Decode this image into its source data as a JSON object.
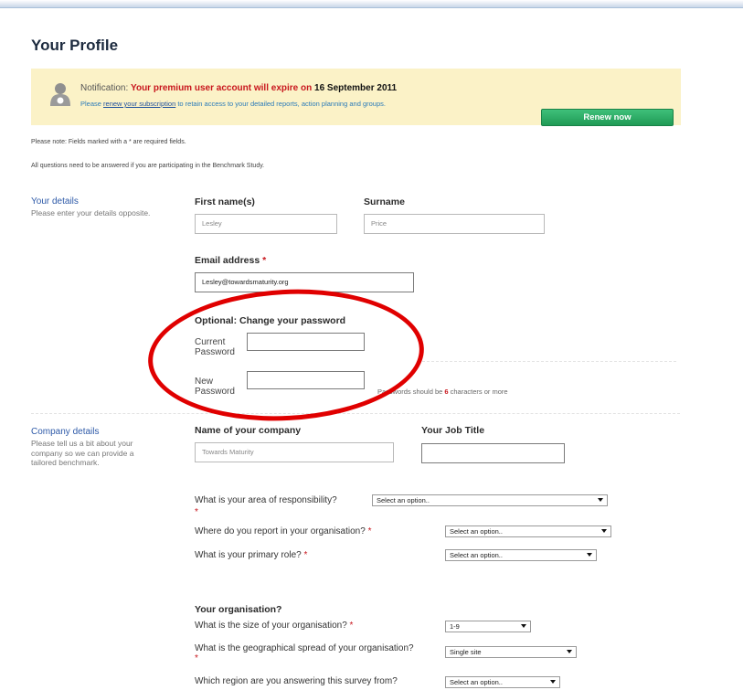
{
  "page": {
    "title": "Your Profile"
  },
  "notification": {
    "prefix": "Notification: ",
    "message": "Your premium user account will expire on ",
    "date": "16 September 2011",
    "line2_before": "Please ",
    "renew_link": "renew your subscription",
    "line2_after": " to retain access to your detailed reports, action planning and groups.",
    "renew_button": "Renew now"
  },
  "notes": {
    "required": "Please note: Fields marked with a * are required fields.",
    "benchmark": "All questions need to be answered if you are participating in the Benchmark Study."
  },
  "your_details": {
    "heading": "Your details",
    "description": "Please enter your details opposite.",
    "first_name_label": "First name(s)",
    "first_name_value": "Lesley",
    "surname_label": "Surname",
    "surname_value": "Price",
    "email_label": "Email address",
    "email_value": "Lesley@towardsmaturity.org",
    "password_heading": "Optional: Change your password",
    "current_password_label": "Current Password",
    "new_password_label": "New Password",
    "hint_before": "Passwords should be ",
    "hint_number": "6",
    "hint_after": " characters or more"
  },
  "company_details": {
    "heading": "Company details",
    "description": "Please tell us a bit about your company so we can provide a tailored benchmark.",
    "company_label": "Name of your company",
    "company_value": "Towards Maturity",
    "job_title_label": "Your Job Title",
    "job_title_value": "",
    "q_responsibility": "What is your area of responsibility?",
    "q_report": "Where do you report in your organisation?",
    "q_role": "What is your primary role?",
    "select_placeholder": "Select an option.."
  },
  "organisation": {
    "heading": "Your organisation?",
    "q_size": "What is the size of your organisation?",
    "size_value": "1-9",
    "q_spread": "What is the geographical spread of your organisation?",
    "spread_value": "Single site",
    "q_region": "Which region are you answering this survey from?",
    "region_value": "Select an option.."
  },
  "required_marker": "*",
  "colors": {
    "accent": "#2e5aa8",
    "notice_bg": "#fbf2c7",
    "renew_green": "#27a862",
    "alert_red": "#c8161d",
    "annotation_red": "#e00000"
  }
}
